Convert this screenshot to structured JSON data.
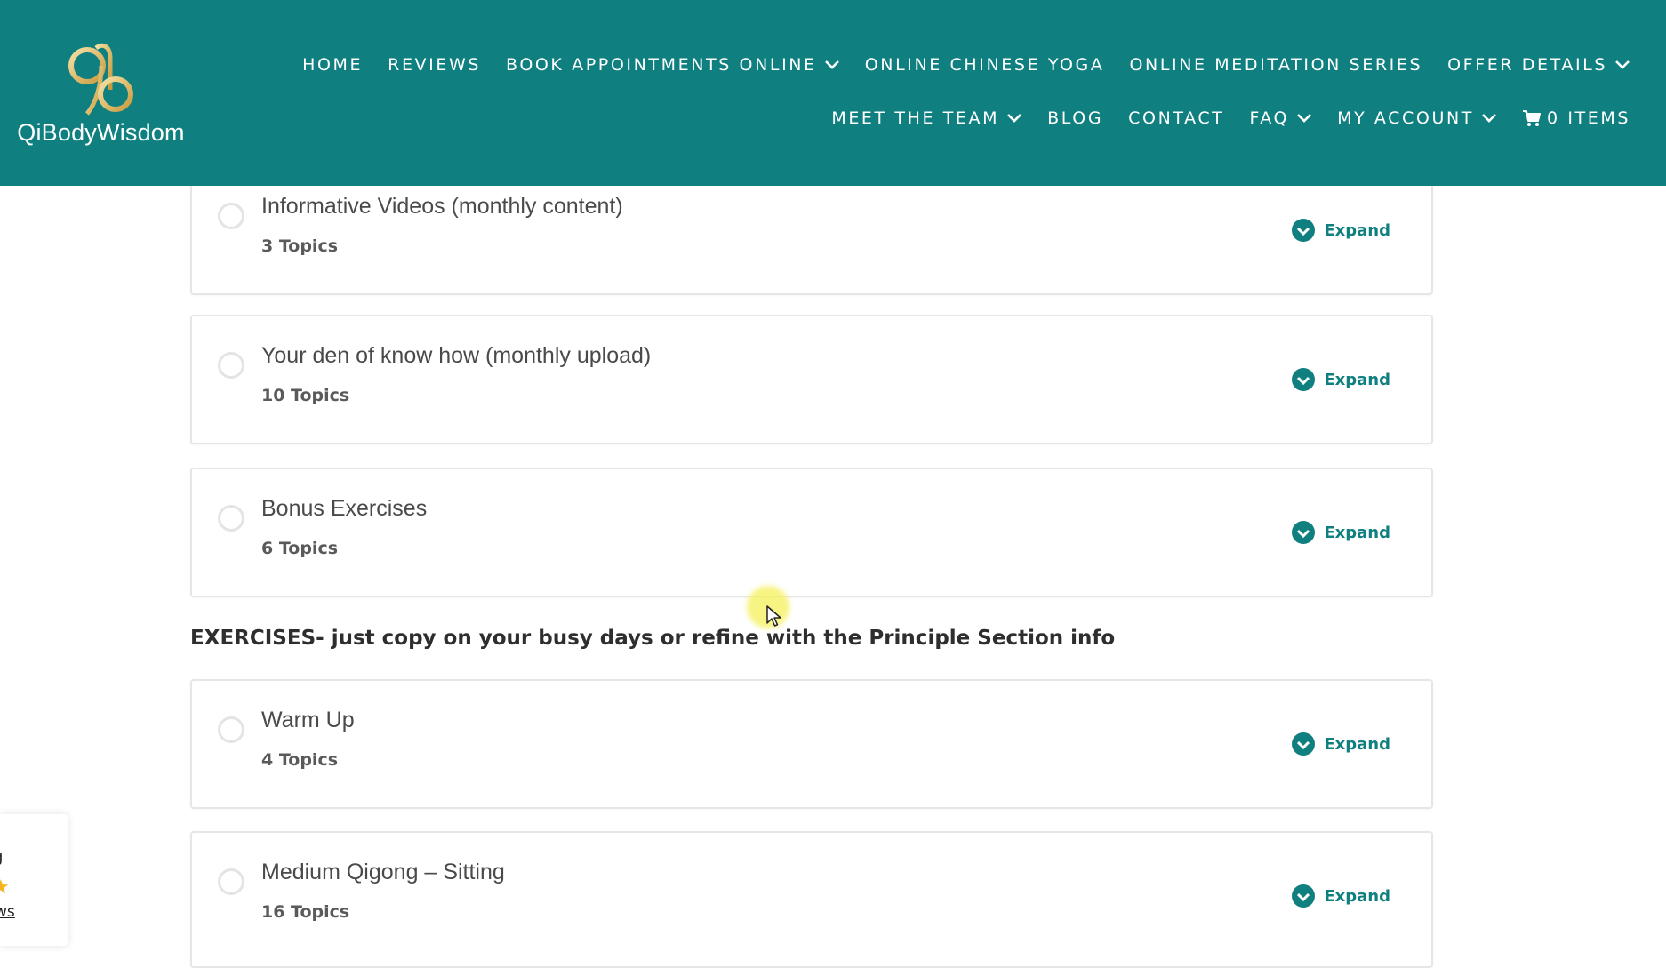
{
  "brand": {
    "name": "QiBodyWisdom"
  },
  "colors": {
    "header_bg": "#0f7f80",
    "accent": "#0f7f80",
    "star": "#f5b31c"
  },
  "nav": {
    "row1": [
      {
        "label": "HOME",
        "dropdown": false
      },
      {
        "label": "REVIEWS",
        "dropdown": false
      },
      {
        "label": "BOOK APPOINTMENTS ONLINE",
        "dropdown": true
      },
      {
        "label": "ONLINE CHINESE YOGA",
        "dropdown": false
      },
      {
        "label": "ONLINE MEDITATION SERIES",
        "dropdown": false
      },
      {
        "label": "OFFER DETAILS",
        "dropdown": true
      }
    ],
    "row2": [
      {
        "label": "MEET THE TEAM",
        "dropdown": true
      },
      {
        "label": "BLOG",
        "dropdown": false
      },
      {
        "label": "CONTACT",
        "dropdown": false
      },
      {
        "label": "FAQ",
        "dropdown": true
      },
      {
        "label": "MY ACCOUNT",
        "dropdown": true
      }
    ],
    "cart": {
      "label": "0 ITEMS",
      "icon": "cart-icon"
    }
  },
  "lessons": [
    {
      "title": "Informative Videos (monthly content)",
      "topics": "3 Topics",
      "action": "Expand"
    },
    {
      "title": "Your den of know how (monthly upload)",
      "topics": "10 Topics",
      "action": "Expand"
    },
    {
      "title": "Bonus Exercises",
      "topics": "6 Topics",
      "action": "Expand"
    }
  ],
  "section": {
    "heading": "EXERCISES- just copy on your busy days or refine with the Principle Section info"
  },
  "section_lessons": [
    {
      "title": "Warm Up",
      "topics": "4 Topics",
      "action": "Expand"
    },
    {
      "title": "Medium Qigong – Sitting",
      "topics": "16 Topics",
      "action": "Expand"
    }
  ],
  "reviews_widget": {
    "text_fragment": "g",
    "star": "★",
    "link_fragment": "ws"
  }
}
